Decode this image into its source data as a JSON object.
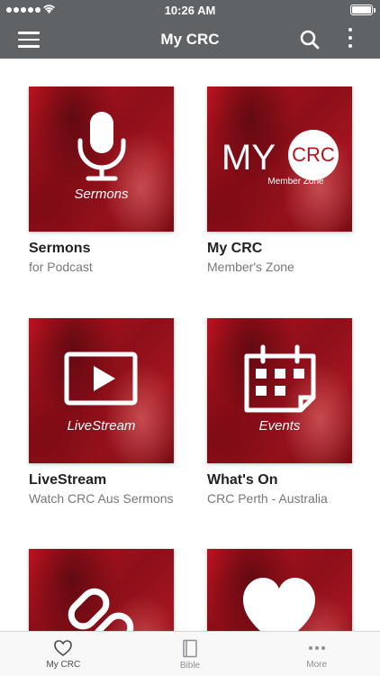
{
  "status_bar": {
    "time": "10:26 AM"
  },
  "nav": {
    "title": "My CRC"
  },
  "tiles": [
    {
      "title": "Sermons",
      "subtitle": "for Podcast",
      "caption": "Sermons",
      "icon": "microphone-icon"
    },
    {
      "title": "My CRC",
      "subtitle": "Member's Zone",
      "logo_text": "MY",
      "logo_badge": "CRC",
      "caption": "Member Zone",
      "icon": "my-crc-logo"
    },
    {
      "title": "LiveStream",
      "subtitle": "Watch CRC Aus Sermons",
      "caption": "LiveStream",
      "icon": "video-play-icon"
    },
    {
      "title": "What's On",
      "subtitle": "CRC Perth - Australia",
      "caption": "Events",
      "icon": "calendar-icon"
    },
    {
      "title": "",
      "subtitle": "",
      "caption": "",
      "icon": "link-icon"
    },
    {
      "title": "",
      "subtitle": "",
      "caption": "",
      "icon": "heart-icon"
    }
  ],
  "tab_bar": {
    "tabs": [
      {
        "label": "My CRC",
        "icon": "heart-outline-icon",
        "active": true
      },
      {
        "label": "Bible",
        "icon": "book-icon",
        "active": false
      },
      {
        "label": "More",
        "icon": "ellipsis-icon",
        "active": false
      }
    ]
  }
}
